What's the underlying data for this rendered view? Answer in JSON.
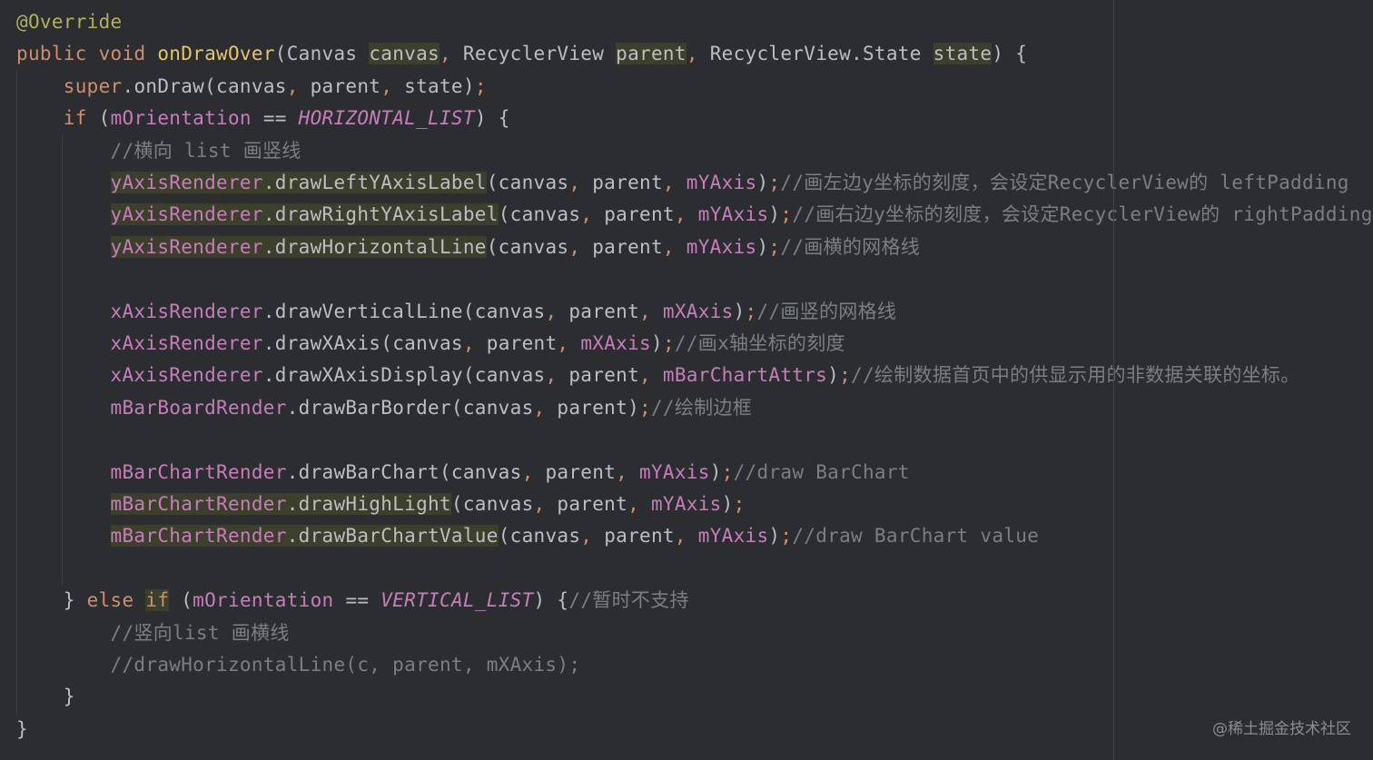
{
  "editor": {
    "watermark": "@稀土掘金技术社区",
    "lines": [
      [
        {
          "t": "@Override",
          "c": "ann"
        }
      ],
      [
        {
          "t": "public ",
          "c": "kw"
        },
        {
          "t": "void ",
          "c": "kw"
        },
        {
          "t": "onDrawOver",
          "c": "fnd"
        },
        {
          "t": "(Canvas ",
          "c": "plain"
        },
        {
          "t": "canvas",
          "c": "plain",
          "h": 1
        },
        {
          "t": ", ",
          "c": "comma"
        },
        {
          "t": "RecyclerView ",
          "c": "plain"
        },
        {
          "t": "parent",
          "c": "plain",
          "h": 1
        },
        {
          "t": ", ",
          "c": "comma"
        },
        {
          "t": "RecyclerView.State ",
          "c": "plain"
        },
        {
          "t": "state",
          "c": "plain",
          "h": 1
        },
        {
          "t": ") {",
          "c": "plain"
        }
      ],
      [
        {
          "t": "    super",
          "c": "kw"
        },
        {
          "t": ".onDraw(canvas",
          "c": "plain"
        },
        {
          "t": ", ",
          "c": "comma"
        },
        {
          "t": "parent",
          "c": "plain"
        },
        {
          "t": ", ",
          "c": "comma"
        },
        {
          "t": "state)",
          "c": "plain"
        },
        {
          "t": ";",
          "c": "semi"
        }
      ],
      [
        {
          "t": "    if ",
          "c": "kw"
        },
        {
          "t": "(",
          "c": "plain"
        },
        {
          "t": "mOrientation",
          "c": "field"
        },
        {
          "t": " == ",
          "c": "plain"
        },
        {
          "t": "HORIZONTAL_LIST",
          "c": "const"
        },
        {
          "t": ") {",
          "c": "plain"
        }
      ],
      [
        {
          "t": "        //横向 list 画竖线",
          "c": "cmt"
        }
      ],
      [
        {
          "t": "        ",
          "c": "plain"
        },
        {
          "t": "yAxisRenderer.drawLeftYAxisLabel",
          "c": "field",
          "h": 1,
          "split": 13
        },
        {
          "t": "(canvas",
          "c": "plain"
        },
        {
          "t": ", ",
          "c": "comma"
        },
        {
          "t": "parent",
          "c": "plain"
        },
        {
          "t": ", ",
          "c": "comma"
        },
        {
          "t": "mYAxis",
          "c": "field"
        },
        {
          "t": ")",
          "c": "plain"
        },
        {
          "t": ";",
          "c": "semi"
        },
        {
          "t": "//画左边y坐标的刻度，会设定RecyclerView的 leftPadding",
          "c": "cmt"
        }
      ],
      [
        {
          "t": "        ",
          "c": "plain"
        },
        {
          "t": "yAxisRenderer.drawRightYAxisLabel",
          "c": "field",
          "h": 1,
          "split": 13
        },
        {
          "t": "(canvas",
          "c": "plain"
        },
        {
          "t": ", ",
          "c": "comma"
        },
        {
          "t": "parent",
          "c": "plain"
        },
        {
          "t": ", ",
          "c": "comma"
        },
        {
          "t": "mYAxis",
          "c": "field"
        },
        {
          "t": ")",
          "c": "plain"
        },
        {
          "t": ";",
          "c": "semi"
        },
        {
          "t": "//画右边y坐标的刻度，会设定RecyclerView的 rightPadding",
          "c": "cmt"
        }
      ],
      [
        {
          "t": "        ",
          "c": "plain"
        },
        {
          "t": "yAxisRenderer.drawHorizontalLine",
          "c": "field",
          "h": 1,
          "split": 13
        },
        {
          "t": "(canvas",
          "c": "plain"
        },
        {
          "t": ", ",
          "c": "comma"
        },
        {
          "t": "parent",
          "c": "plain"
        },
        {
          "t": ", ",
          "c": "comma"
        },
        {
          "t": "mYAxis",
          "c": "field"
        },
        {
          "t": ")",
          "c": "plain"
        },
        {
          "t": ";",
          "c": "semi"
        },
        {
          "t": "//画横的网格线",
          "c": "cmt"
        }
      ],
      [],
      [
        {
          "t": "        ",
          "c": "plain"
        },
        {
          "t": "xAxisRenderer.drawVerticalLine",
          "c": "field",
          "split": 13
        },
        {
          "t": "(canvas",
          "c": "plain"
        },
        {
          "t": ", ",
          "c": "comma"
        },
        {
          "t": "parent",
          "c": "plain"
        },
        {
          "t": ", ",
          "c": "comma"
        },
        {
          "t": "mXAxis",
          "c": "field"
        },
        {
          "t": ")",
          "c": "plain"
        },
        {
          "t": ";",
          "c": "semi"
        },
        {
          "t": "//画竖的网格线",
          "c": "cmt"
        }
      ],
      [
        {
          "t": "        ",
          "c": "plain"
        },
        {
          "t": "xAxisRenderer.drawXAxis",
          "c": "field",
          "split": 13
        },
        {
          "t": "(canvas",
          "c": "plain"
        },
        {
          "t": ", ",
          "c": "comma"
        },
        {
          "t": "parent",
          "c": "plain"
        },
        {
          "t": ", ",
          "c": "comma"
        },
        {
          "t": "mXAxis",
          "c": "field"
        },
        {
          "t": ")",
          "c": "plain"
        },
        {
          "t": ";",
          "c": "semi"
        },
        {
          "t": "//画x轴坐标的刻度",
          "c": "cmt"
        }
      ],
      [
        {
          "t": "        ",
          "c": "plain"
        },
        {
          "t": "xAxisRenderer.drawXAxisDisplay",
          "c": "field",
          "split": 13
        },
        {
          "t": "(canvas",
          "c": "plain"
        },
        {
          "t": ", ",
          "c": "comma"
        },
        {
          "t": "parent",
          "c": "plain"
        },
        {
          "t": ", ",
          "c": "comma"
        },
        {
          "t": "mBarChartAttrs",
          "c": "field"
        },
        {
          "t": ")",
          "c": "plain"
        },
        {
          "t": ";",
          "c": "semi"
        },
        {
          "t": "//绘制数据首页中的供显示用的非数据关联的坐标。",
          "c": "cmt"
        }
      ],
      [
        {
          "t": "        ",
          "c": "plain"
        },
        {
          "t": "mBarBoardRender.drawBarBorder",
          "c": "field",
          "split": 15
        },
        {
          "t": "(canvas",
          "c": "plain"
        },
        {
          "t": ", ",
          "c": "comma"
        },
        {
          "t": "parent)",
          "c": "plain"
        },
        {
          "t": ";",
          "c": "semi"
        },
        {
          "t": "//绘制边框",
          "c": "cmt"
        }
      ],
      [],
      [
        {
          "t": "        ",
          "c": "plain"
        },
        {
          "t": "mBarChartRender.drawBarChart",
          "c": "field",
          "split": 15
        },
        {
          "t": "(canvas",
          "c": "plain"
        },
        {
          "t": ", ",
          "c": "comma"
        },
        {
          "t": "parent",
          "c": "plain"
        },
        {
          "t": ", ",
          "c": "comma"
        },
        {
          "t": "mYAxis",
          "c": "field"
        },
        {
          "t": ")",
          "c": "plain"
        },
        {
          "t": ";",
          "c": "semi"
        },
        {
          "t": "//draw BarChart",
          "c": "cmt"
        }
      ],
      [
        {
          "t": "        ",
          "c": "plain"
        },
        {
          "t": "mBarChartRender.drawHighLight",
          "c": "field",
          "h": 1,
          "split": 15
        },
        {
          "t": "(canvas",
          "c": "plain"
        },
        {
          "t": ", ",
          "c": "comma"
        },
        {
          "t": "parent",
          "c": "plain"
        },
        {
          "t": ", ",
          "c": "comma"
        },
        {
          "t": "mYAxis",
          "c": "field"
        },
        {
          "t": ")",
          "c": "plain"
        },
        {
          "t": ";",
          "c": "semi"
        }
      ],
      [
        {
          "t": "        ",
          "c": "plain"
        },
        {
          "t": "mBarChartRender.drawBarChartValue",
          "c": "field",
          "h": 1,
          "split": 15
        },
        {
          "t": "(canvas",
          "c": "plain"
        },
        {
          "t": ", ",
          "c": "comma"
        },
        {
          "t": "parent",
          "c": "plain"
        },
        {
          "t": ", ",
          "c": "comma"
        },
        {
          "t": "mYAxis",
          "c": "field"
        },
        {
          "t": ")",
          "c": "plain"
        },
        {
          "t": ";",
          "c": "semi"
        },
        {
          "t": "//draw BarChart value",
          "c": "cmt"
        }
      ],
      [],
      [
        {
          "t": "    } ",
          "c": "plain"
        },
        {
          "t": "else ",
          "c": "kw"
        },
        {
          "t": "if",
          "c": "kw",
          "h": 1
        },
        {
          "t": " (",
          "c": "plain"
        },
        {
          "t": "mOrientation",
          "c": "field"
        },
        {
          "t": " == ",
          "c": "plain"
        },
        {
          "t": "VERTICAL_LIST",
          "c": "const"
        },
        {
          "t": ") {",
          "c": "plain"
        },
        {
          "t": "//暂时不支持",
          "c": "cmt"
        }
      ],
      [
        {
          "t": "        //竖向list 画横线",
          "c": "cmt"
        }
      ],
      [
        {
          "t": "        //drawHorizontalLine(c, parent, mXAxis);",
          "c": "cmt"
        }
      ],
      [
        {
          "t": "    }",
          "c": "plain"
        }
      ],
      [
        {
          "t": "}",
          "c": "plain"
        }
      ]
    ]
  }
}
